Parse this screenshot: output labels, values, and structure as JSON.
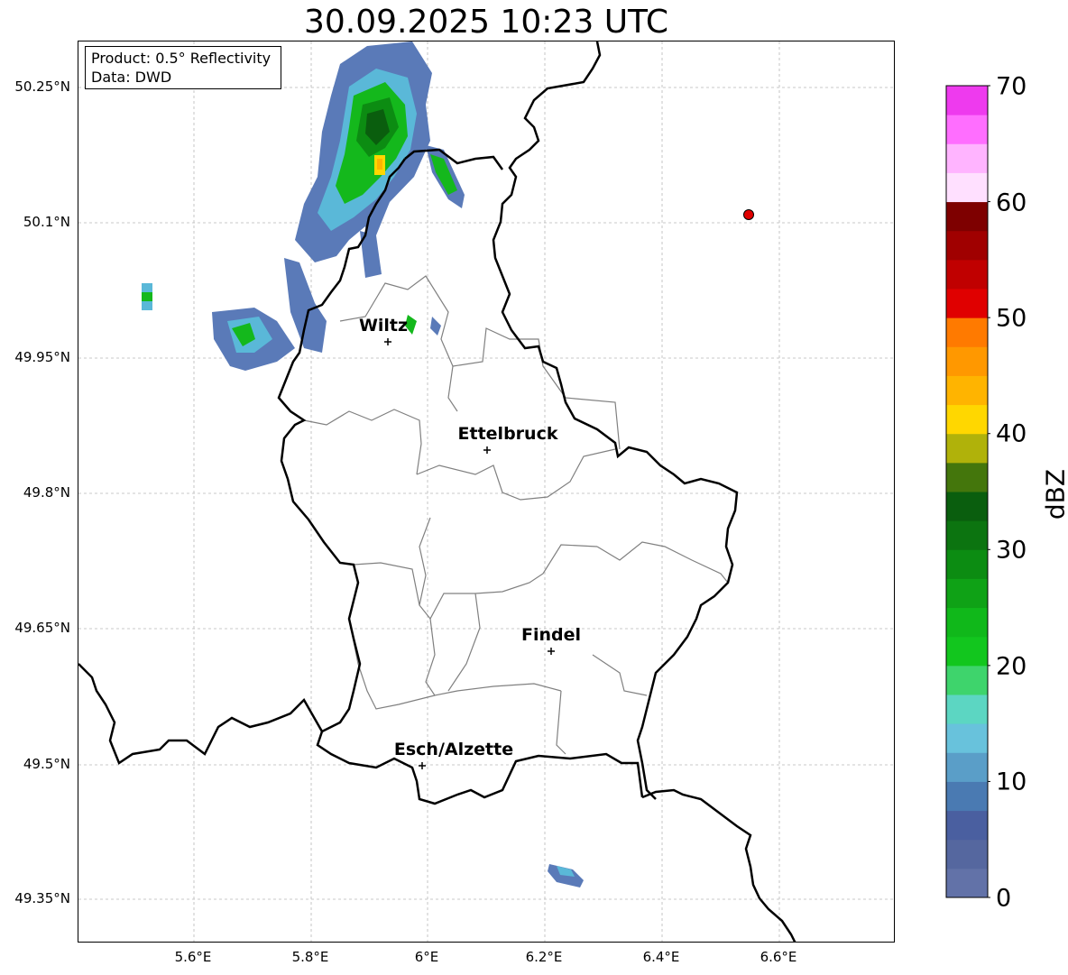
{
  "title": "30.09.2025 10:23 UTC",
  "info_box": {
    "line1": "Product: 0.5° Reflectivity",
    "line2": "Data: DWD"
  },
  "lat_ticks": [
    "50.25°N",
    "50.1°N",
    "49.95°N",
    "49.8°N",
    "49.65°N",
    "49.5°N",
    "49.35°N"
  ],
  "lon_ticks": [
    "5.6°E",
    "5.8°E",
    "6°E",
    "6.2°E",
    "6.4°E",
    "6.6°E"
  ],
  "cities": [
    {
      "name": "Wiltz"
    },
    {
      "name": "Ettelbruck"
    },
    {
      "name": "Findel"
    },
    {
      "name": "Esch/Alzette"
    }
  ],
  "colorbar": {
    "label": "dBZ",
    "ticks": [
      "70",
      "60",
      "50",
      "40",
      "30",
      "20",
      "10",
      "0"
    ],
    "colors": [
      "#6272a8",
      "#55679f",
      "#4a5fa0",
      "#4a7ab2",
      "#5a9ec8",
      "#68c2dc",
      "#5cd6c2",
      "#3ed46c",
      "#12c61e",
      "#10b81a",
      "#0fa216",
      "#0c8c12",
      "#0c7410",
      "#0a5e0e",
      "#44760c",
      "#b0b20a",
      "#ffd700",
      "#ffb400",
      "#ff9800",
      "#ff7a00",
      "#e00000",
      "#c00000",
      "#a00000",
      "#7e0000",
      "#ffe0ff",
      "#ffb4ff",
      "#ff6eff",
      "#ee3aee"
    ]
  },
  "colors": {
    "border": "#000000",
    "canton": "#808080",
    "marker": "#e00000"
  }
}
